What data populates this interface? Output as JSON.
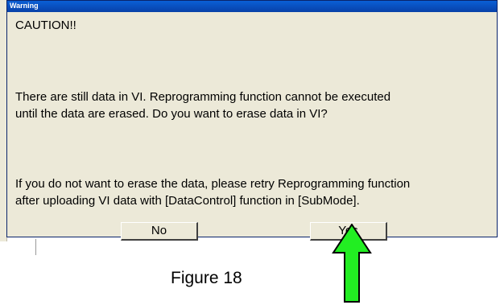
{
  "window": {
    "title": "Warning"
  },
  "dialog": {
    "heading": "CAUTION!!",
    "message1_line1": "There are still data in VI. Reprogramming function cannot be executed",
    "message1_line2": "until the data are erased. Do you want to erase data in VI?",
    "message2_line1": "If you do not want to erase the data, please retry Reprogramming function",
    "message2_line2": "after uploading VI data with [DataControl] function in [SubMode]."
  },
  "buttons": {
    "no_label": "No",
    "yes_label": "Yes"
  },
  "caption": "Figure 18",
  "colors": {
    "arrow": "#22ee22",
    "titlebar": "#0a5fd6",
    "dialog_bg": "#ece9d8"
  }
}
